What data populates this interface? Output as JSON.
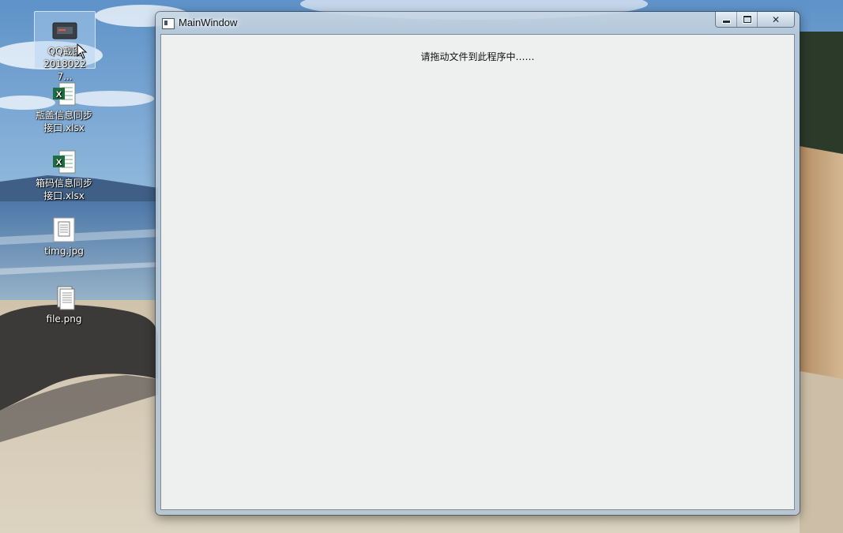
{
  "desktop": {
    "icons": [
      {
        "label": "QQ截图2018022​7...",
        "line1": "QQ截图",
        "line2": "20180227...",
        "type": "image"
      },
      {
        "label": "瓶盖信息同步接口.xlsx",
        "line1": "瓶盖信息同步",
        "line2": "接口.xlsx",
        "type": "excel"
      },
      {
        "label": "箱码信息同步接口.xlsx",
        "line1": "箱码信息同步",
        "line2": "接口.xlsx",
        "type": "excel"
      },
      {
        "label": "timg.jpg",
        "line1": "timg.jpg",
        "line2": "",
        "type": "document"
      },
      {
        "label": "file.png",
        "line1": "file.png",
        "line2": "",
        "type": "document"
      }
    ]
  },
  "window": {
    "title": "MainWindow",
    "controls": {
      "minimize": "",
      "maximize": "",
      "close": "✕"
    },
    "hint": "请拖动文件到此程序中……"
  },
  "colors": {
    "client_bg": "#eef0f0",
    "excel_green": "#1d6f42",
    "sky": "#7fa9cf",
    "sand": "#d8cdb8"
  }
}
